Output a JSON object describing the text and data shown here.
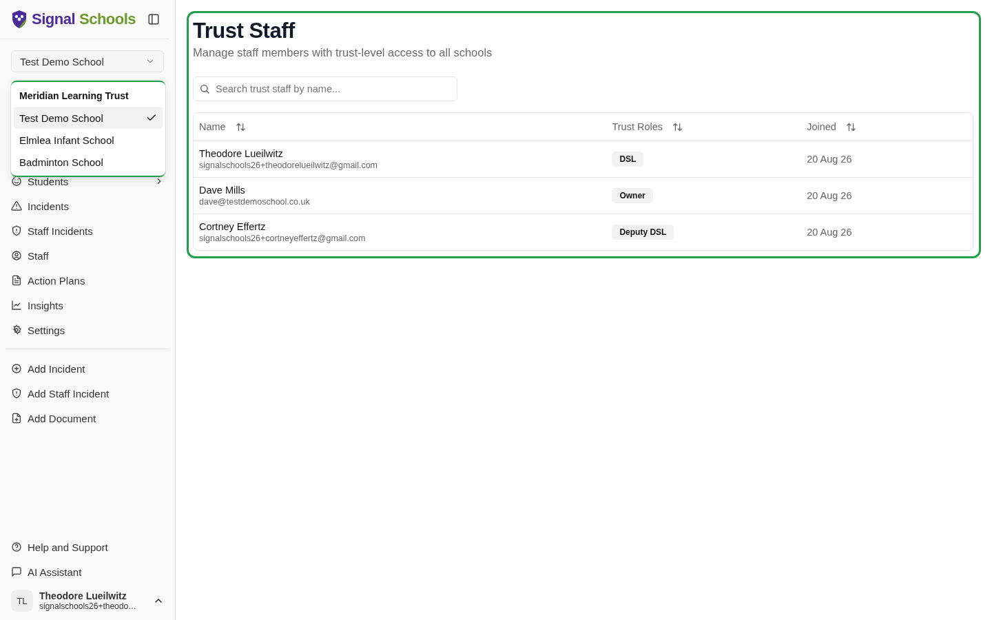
{
  "sidebar": {
    "brand": [
      {
        "text": "Signal",
        "color": "#4b2a9a"
      },
      {
        "text": "Schools",
        "color": "#6b9a2c"
      }
    ],
    "school_select": {
      "value": "Test Demo School"
    },
    "school_menu": {
      "group": "Meridian Learning Trust",
      "items": [
        {
          "label": "Test Demo School",
          "selected": true
        },
        {
          "label": "Elmlea Infant School",
          "selected": false
        },
        {
          "label": "Badminton School",
          "selected": false
        }
      ]
    },
    "nav": [
      {
        "label": "Students",
        "expandable": true
      },
      {
        "label": "Incidents",
        "expandable": false
      },
      {
        "label": "Staff Incidents",
        "expandable": false
      },
      {
        "label": "Staff",
        "expandable": false
      },
      {
        "label": "Action Plans",
        "expandable": false
      },
      {
        "label": "Insights",
        "expandable": false
      },
      {
        "label": "Settings",
        "expandable": false
      }
    ],
    "actions": [
      "Add Incident",
      "Add Staff Incident",
      "Add Document"
    ],
    "footer_links": [
      "Help and Support",
      "AI Assistant"
    ],
    "user": {
      "initials": "TL",
      "name": "Theodore Lueilwitz",
      "email": "signalschools26+theodo…"
    }
  },
  "page": {
    "title": "Trust Staff",
    "subtitle": "Manage staff members with trust-level access to all schools",
    "search": {
      "placeholder": "Search trust staff by name..."
    },
    "table": {
      "columns": [
        "Name",
        "Trust Roles",
        "Joined"
      ],
      "rows": [
        {
          "name": "Theodore Lueilwitz",
          "email": "signalschools26+theodorelueilwitz@gmail.com",
          "role": "DSL",
          "joined": "20 Aug 26"
        },
        {
          "name": "Dave Mills",
          "email": "dave@testdemoschool.co.uk",
          "role": "Owner",
          "joined": "20 Aug 26"
        },
        {
          "name": "Cortney Effertz",
          "email": "signalschools26+cortneyeffertz@gmail.com",
          "role": "Deputy DSL",
          "joined": "20 Aug 26"
        }
      ]
    }
  }
}
